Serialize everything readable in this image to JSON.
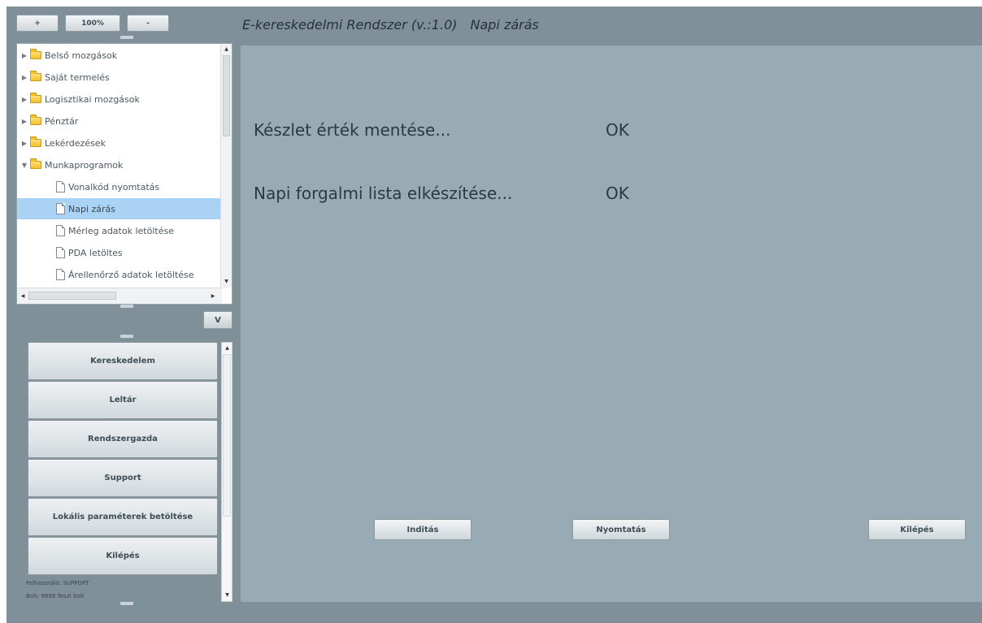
{
  "toolbar": {
    "zoom_in_label": "+",
    "zoom_level_label": "100%",
    "zoom_out_label": "-"
  },
  "header": {
    "app_title": "E-kereskedelmi Rendszer (v.:1.0)",
    "page_title": "Napi zárás"
  },
  "tree": {
    "items": [
      {
        "label": "Belső mozgások",
        "type": "folder",
        "expander": "▶"
      },
      {
        "label": "Saját termelés",
        "type": "folder",
        "expander": "▶"
      },
      {
        "label": "Logisztikai mozgások",
        "type": "folder",
        "expander": "▶"
      },
      {
        "label": "Pénztár",
        "type": "folder",
        "expander": "▶"
      },
      {
        "label": "Lekérdezések",
        "type": "folder",
        "expander": "▶"
      },
      {
        "label": "Munkaprogramok",
        "type": "folder-open",
        "expander": "▼"
      },
      {
        "label": "Vonalkód nyomtatás",
        "type": "document"
      },
      {
        "label": "Napi zárás",
        "type": "document",
        "selected": true
      },
      {
        "label": "Mérleg adatok letöltése",
        "type": "document"
      },
      {
        "label": "PDA letöltes",
        "type": "document"
      },
      {
        "label": "Árellenőrző adatok letöltése",
        "type": "document"
      }
    ],
    "collapse_button_label": "V"
  },
  "nav": {
    "buttons": [
      {
        "label": "Kereskedelem"
      },
      {
        "label": "Leltár"
      },
      {
        "label": "Rendszergazda"
      },
      {
        "label": "Support"
      },
      {
        "label": "Lokális paraméterek betöltése"
      },
      {
        "label": "Kilépés"
      }
    ],
    "user_line": "Felhasználó: SUPPORT",
    "extra_line": "Bolt:      9999 Teszt bolt"
  },
  "main": {
    "status_lines": [
      {
        "label": "Készlet érték mentése...",
        "result": "OK"
      },
      {
        "label": "Napi forgalmi lista elkészítése...",
        "result": "OK"
      }
    ],
    "actions": {
      "start_label": "Inditás",
      "print_label": "Nyomtatás",
      "exit_label": "Kilépés"
    }
  },
  "colors": {
    "frame_bg": "#7f9099",
    "main_bg": "#98abb5",
    "selection_bg": "#aad2f5",
    "folder_yellow": "#f1c130"
  },
  "icons": {
    "folder": "folder-icon",
    "document": "document-icon",
    "expand": "triangle-right-icon",
    "collapse": "triangle-down-icon"
  }
}
